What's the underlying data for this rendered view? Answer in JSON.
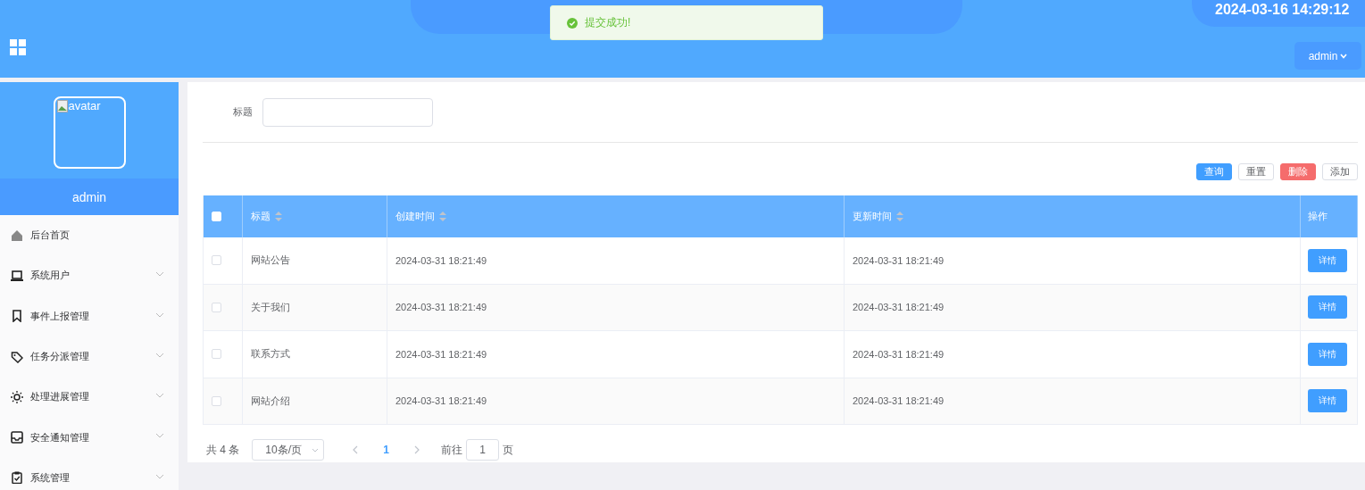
{
  "header": {
    "datetime": "2024-03-16 14:29:12",
    "user_menu": "admin"
  },
  "toast": {
    "message": "提交成功!"
  },
  "sidebar": {
    "avatar_alt": "avatar",
    "username": "admin",
    "items": [
      {
        "label": "后台首页",
        "kind": "home",
        "expandable": false
      },
      {
        "label": "系统用户",
        "kind": "laptop",
        "expandable": true
      },
      {
        "label": "事件上报管理",
        "kind": "bookmark",
        "expandable": true
      },
      {
        "label": "任务分派管理",
        "kind": "tag",
        "expandable": true
      },
      {
        "label": "处理进展管理",
        "kind": "sun",
        "expandable": true
      },
      {
        "label": "安全通知管理",
        "kind": "inbox",
        "expandable": true
      },
      {
        "label": "系统管理",
        "kind": "clipboard",
        "expandable": true
      }
    ]
  },
  "search": {
    "label": "标题"
  },
  "actions": [
    {
      "label": "查询",
      "kind": "primary"
    },
    {
      "label": "重置",
      "kind": "plain"
    },
    {
      "label": "删除",
      "kind": "danger"
    },
    {
      "label": "添加",
      "kind": "plain"
    }
  ],
  "table": {
    "select_all_checked": false,
    "columns": [
      {
        "label": "标题",
        "sortable": true
      },
      {
        "label": "创建时间",
        "sortable": true
      },
      {
        "label": "更新时间",
        "sortable": true
      },
      {
        "label": "操作",
        "sortable": false
      }
    ],
    "rows": [
      {
        "checked": false,
        "cells": [
          "网站公告",
          "2024-03-31 18:21:49",
          "2024-03-31 18:21:49"
        ],
        "action": "详情"
      },
      {
        "checked": false,
        "cells": [
          "关于我们",
          "2024-03-31 18:21:49",
          "2024-03-31 18:21:49"
        ],
        "action": "详情"
      },
      {
        "checked": false,
        "cells": [
          "联系方式",
          "2024-03-31 18:21:49",
          "2024-03-31 18:21:49"
        ],
        "action": "详情"
      },
      {
        "checked": false,
        "cells": [
          "网站介绍",
          "2024-03-31 18:21:49",
          "2024-03-31 18:21:49"
        ],
        "action": "详情"
      }
    ]
  },
  "pagination": {
    "total": "共 4 条",
    "page_size": "10条/页",
    "pages": [
      {
        "label": "1",
        "selected": true
      }
    ],
    "goto_label": "前往",
    "goto_value": "1",
    "goto_suffix": "页"
  }
}
